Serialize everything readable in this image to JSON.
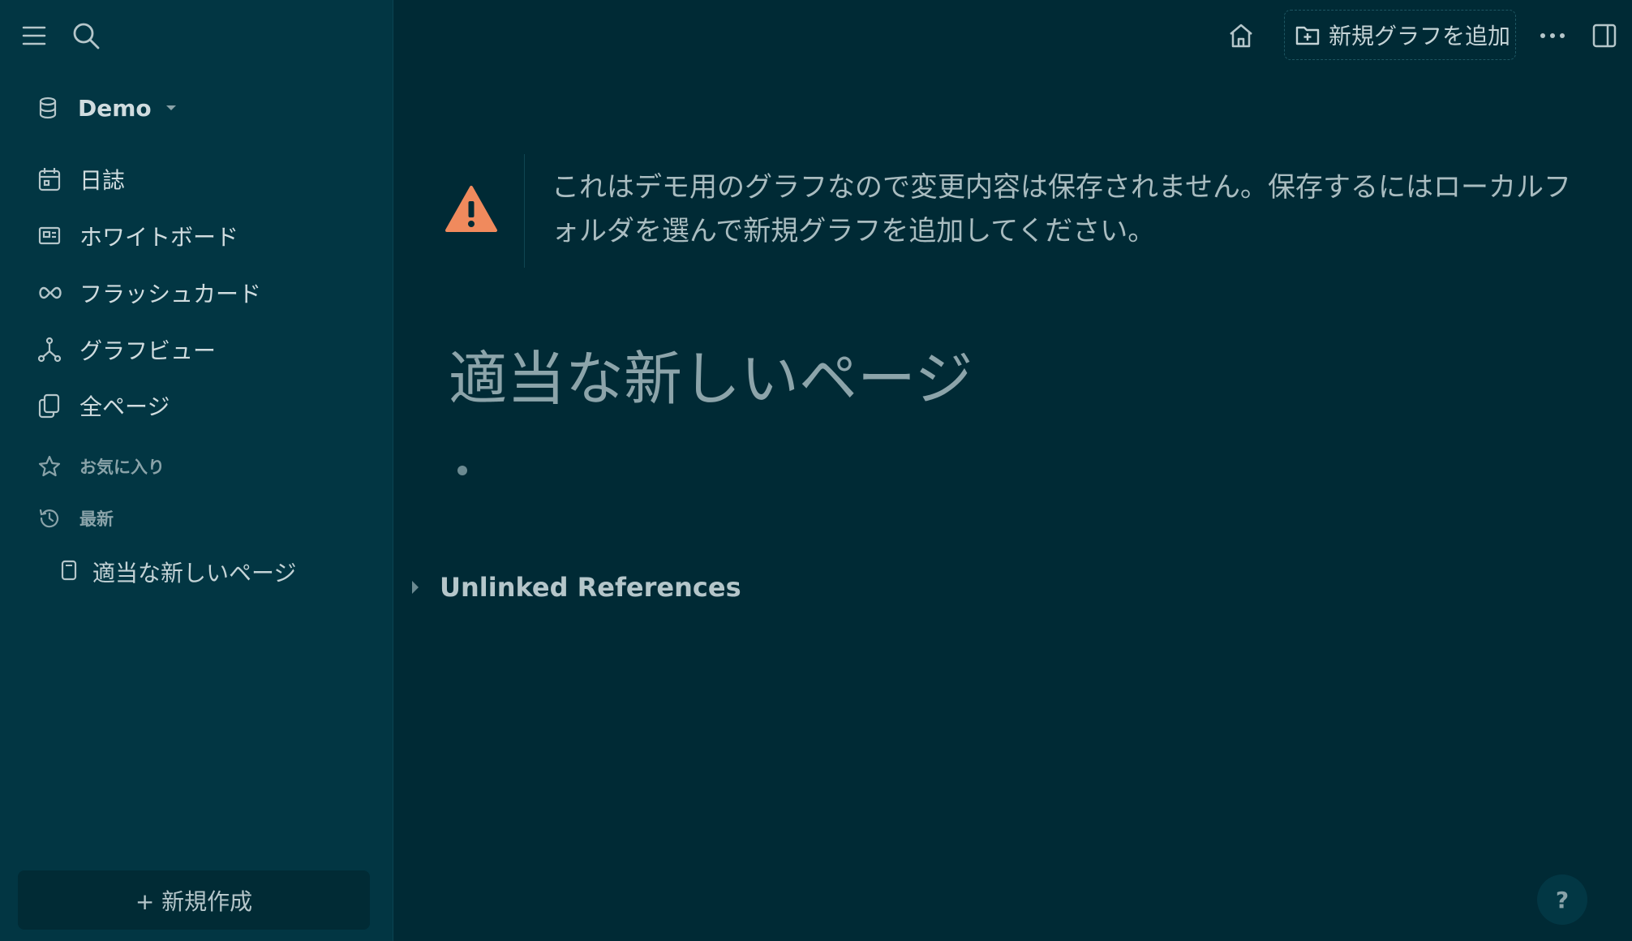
{
  "sidebar": {
    "graph_name": "Demo",
    "nav": [
      {
        "label": "日誌",
        "icon": "calendar-icon"
      },
      {
        "label": "ホワイトボード",
        "icon": "whiteboard-icon"
      },
      {
        "label": "フラッシュカード",
        "icon": "infinity-icon"
      },
      {
        "label": "グラフビュー",
        "icon": "graph-icon"
      },
      {
        "label": "全ページ",
        "icon": "pages-icon"
      }
    ],
    "favorites_label": "お気に入り",
    "recent_label": "最新",
    "recent_items": [
      {
        "label": "適当な新しいページ",
        "icon": "page-icon"
      }
    ],
    "new_button": "+ 新規作成"
  },
  "header": {
    "add_graph_label": "新規グラフを追加"
  },
  "main": {
    "warning_text": "これはデモ用のグラフなので変更内容は保存されません。保存するにはローカルフォルダを選んで新規グラフを追加してください。",
    "page_title": "適当な新しいページ",
    "unlinked_references": "Unlinked References",
    "help": "?"
  },
  "colors": {
    "background": "#002a35",
    "sidebar": "#023643",
    "warning": "#f08a5d",
    "text": "#c4d3d6"
  }
}
